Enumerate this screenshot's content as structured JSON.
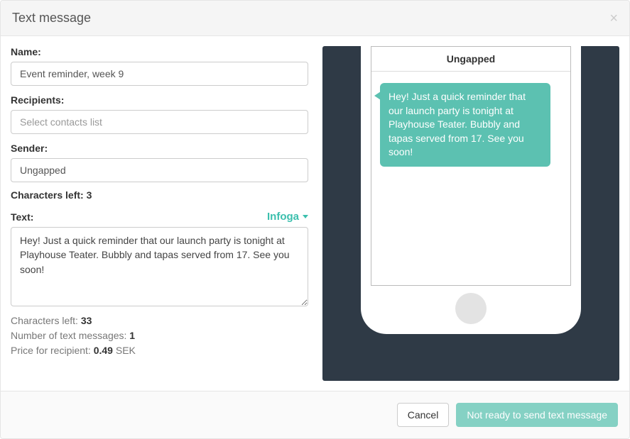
{
  "modal": {
    "title": "Text message"
  },
  "form": {
    "name_label": "Name:",
    "name_value": "Event reminder, week 9",
    "recipients_label": "Recipients:",
    "recipients_placeholder": "Select contacts list",
    "sender_label": "Sender:",
    "sender_value": "Ungapped",
    "sender_chars_left_label": "Characters left: ",
    "sender_chars_left_value": "3",
    "text_label": "Text:",
    "infoga_label": "Infoga",
    "text_value": "Hey! Just a quick reminder that our launch party is tonight at Playhouse Teater. Bubbly and tapas served from 17. See you soon!"
  },
  "stats": {
    "chars_left_label": "Characters left: ",
    "chars_left_value": "33",
    "num_messages_label": "Number of text messages: ",
    "num_messages_value": "1",
    "price_label": "Price for recipient: ",
    "price_value": "0.49",
    "price_suffix": " SEK"
  },
  "preview": {
    "sender": "Ungapped",
    "bubble_text": "Hey! Just a quick reminder that our launch party is tonight at Playhouse Teater. Bubbly and tapas served from 17. See you soon!"
  },
  "footer": {
    "cancel_label": "Cancel",
    "send_label": "Not ready to send text message"
  }
}
